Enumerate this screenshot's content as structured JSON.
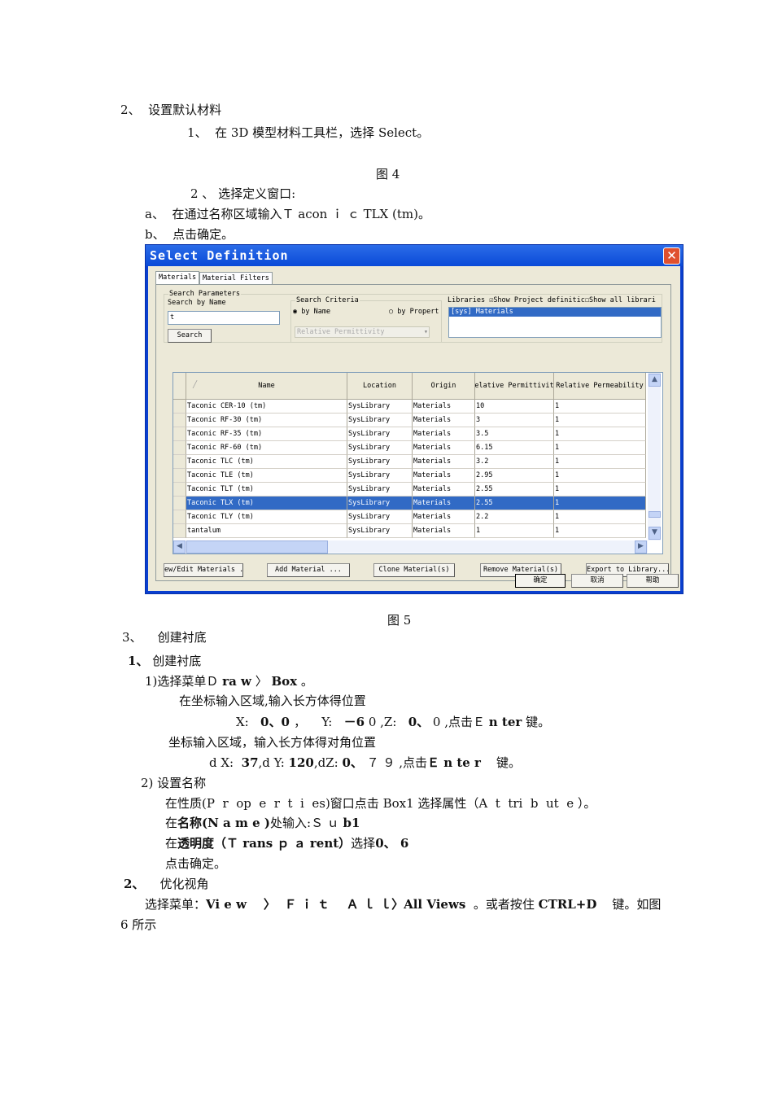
{
  "doc": {
    "lines": [
      [
        {
          "t": "2、  设置默认材料"
        }
      ],
      [
        {
          "t": "1、  在 3D 模型材料工具栏，选择 Select。"
        }
      ],
      [
        {
          "t": "2 、 选择定义窗口:"
        }
      ],
      [
        {
          "t": "a、  在通过名称区域输入Ｔ acon ｉ ｃ TLX (tm)。"
        }
      ],
      [
        {
          "t": "b、  点击确定。"
        }
      ],
      [
        {
          "t": "3、    创建衬底"
        }
      ],
      [
        {
          "t": "1、",
          "b": true
        },
        {
          "t": " 创建衬底"
        }
      ],
      [
        {
          "t": "1)选择菜单Ｄ "
        },
        {
          "t": "ra w",
          "b": true
        },
        {
          "t": " 〉 "
        },
        {
          "t": "Box",
          "b": true
        },
        {
          "t": " 。"
        }
      ],
      [
        {
          "t": "在坐标输入区域,输入长方体得位置"
        }
      ],
      [
        {
          "t": "X:   "
        },
        {
          "t": "0、0 ",
          "b": true
        },
        {
          "t": "，    Y:   "
        },
        {
          "t": "－6",
          "b": true
        },
        {
          "t": " 0 ,Z:   "
        },
        {
          "t": "0、",
          "b": true
        },
        {
          "t": " 0 ,点击Ｅ "
        },
        {
          "t": "n ter",
          "b": true
        },
        {
          "t": " 键。"
        }
      ],
      [
        {
          "t": "坐标输入区域，输入长方体得对角位置"
        }
      ],
      [
        {
          "t": "d X:  "
        },
        {
          "t": "37",
          "b": true
        },
        {
          "t": ",d Y: "
        },
        {
          "t": "120",
          "b": true
        },
        {
          "t": ",dZ: "
        },
        {
          "t": "0、",
          "b": true
        },
        {
          "t": " ７ ９ ,点击"
        },
        {
          "t": "Ｅ n te r",
          "b": true
        },
        {
          "t": "    键。"
        }
      ],
      [
        {
          "t": "2) 设置名称"
        }
      ],
      [
        {
          "t": "在性质(P  r  op  e  r  t  i  es)窗口点击 Box1 选择属性（A  t  tri  b  ut  e ）。"
        }
      ],
      [
        {
          "t": "在"
        },
        {
          "t": "名称(N a m e )",
          "b": true
        },
        {
          "t": "处输入:Ｓ ｕ "
        },
        {
          "t": "b1",
          "b": true
        }
      ],
      [
        {
          "t": "在"
        },
        {
          "t": "透明度（Ｔ rans ｐ ａ rent）",
          "b": true
        },
        {
          "t": "选择"
        },
        {
          "t": "0、 6",
          "b": true
        }
      ],
      [
        {
          "t": "点击确定。"
        }
      ],
      [
        {
          "t": "2、",
          "b": true
        },
        {
          "t": "    优化视角"
        }
      ],
      [
        {
          "t": "选择菜单："
        },
        {
          "t": "Vi e w    〉  Ｆ ｉ ｔ    Ａ ｌ ｌ〉All Views",
          "b": true
        },
        {
          "t": "  。或者按住 "
        },
        {
          "t": "CTRL+D",
          "b": true
        },
        {
          "t": "    键。如图"
        }
      ],
      [
        {
          "t": "6 所示"
        }
      ]
    ],
    "fig4": "图 4",
    "fig5": "图 5"
  },
  "dialog": {
    "title": "Select Definition",
    "tabs": [
      "Materials",
      "Material Filters"
    ],
    "search_params": "Search Parameters",
    "search_by_name": "Search by Name",
    "search_value": "t",
    "search_btn": "Search",
    "criteria": "Search Criteria",
    "by_name": "by Name",
    "by_property": "by Propert",
    "property_select": "Relative Permittivity",
    "libraries": "Libraries",
    "show_project": "Show Project definitic",
    "show_all": "Show all librari",
    "library_items": [
      "[sys] Materials"
    ],
    "columns": [
      "Name",
      "Location",
      "Origin",
      "Relative Permittivity",
      "Relative Permeability"
    ],
    "rows": [
      [
        "Taconic CER-10 (tm)",
        "SysLibrary",
        "Materials",
        "10",
        "1"
      ],
      [
        "Taconic RF-30 (tm)",
        "SysLibrary",
        "Materials",
        "3",
        "1"
      ],
      [
        "Taconic RF-35 (tm)",
        "SysLibrary",
        "Materials",
        "3.5",
        "1"
      ],
      [
        "Taconic RF-60 (tm)",
        "SysLibrary",
        "Materials",
        "6.15",
        "1"
      ],
      [
        "Taconic TLC (tm)",
        "SysLibrary",
        "Materials",
        "3.2",
        "1"
      ],
      [
        "Taconic TLE (tm)",
        "SysLibrary",
        "Materials",
        "2.95",
        "1"
      ],
      [
        "Taconic TLT (tm)",
        "SysLibrary",
        "Materials",
        "2.55",
        "1"
      ],
      [
        "Taconic TLX (tm)",
        "SysLibrary",
        "Materials",
        "2.55",
        "1"
      ],
      [
        "Taconic TLY (tm)",
        "SysLibrary",
        "Materials",
        "2.2",
        "1"
      ],
      [
        "tantalum",
        "SysLibrary",
        "Materials",
        "1",
        "1"
      ]
    ],
    "selected_row": 7,
    "actions": [
      "ew/Edit Materials .",
      "Add Material ...",
      "Clone Material(s)",
      "Remove Material(s)",
      "Export to Library..."
    ],
    "ok": "确定",
    "cancel": "取消",
    "help": "帮助"
  }
}
